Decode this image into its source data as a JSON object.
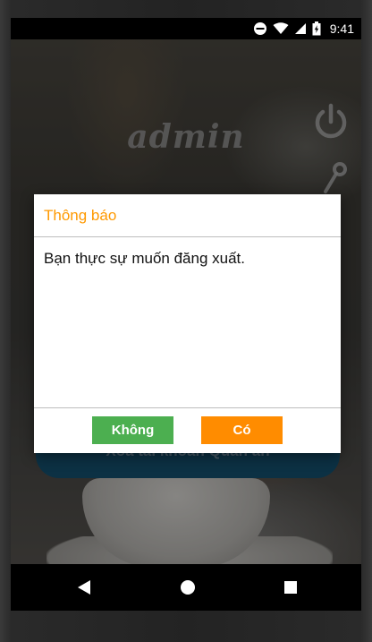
{
  "status_bar": {
    "time": "9:41",
    "icons": [
      "do-not-disturb-icon",
      "wifi-icon",
      "signal-icon",
      "battery-charging-icon"
    ]
  },
  "app": {
    "title": "admin",
    "panel_button_label": "Xóa tài khoản Quán ăn",
    "icons": [
      "power-icon",
      "key-icon"
    ]
  },
  "dialog": {
    "title": "Thông báo",
    "message": "Bạn thực sự muốn đăng xuất.",
    "negative_label": "Không",
    "positive_label": "Có",
    "colors": {
      "title": "#ff9900",
      "negative_button": "#4caf50",
      "positive_button": "#ff8c00"
    }
  },
  "nav_bar": {
    "icons": [
      "back-icon",
      "home-icon",
      "recents-icon"
    ]
  }
}
